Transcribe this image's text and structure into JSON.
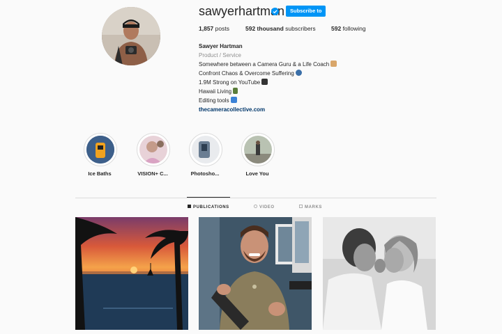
{
  "profile": {
    "username": "sawyerhartman",
    "subscribe_label": "Subscribe to",
    "posts_count": "1,857",
    "posts_label": "posts",
    "subscribers_count": "592 thousand",
    "subscribers_label": "subscribers",
    "following_count": "592",
    "following_label": "following"
  },
  "bio": {
    "name": "Sawyer Hartman",
    "category": "Product / Service",
    "lines": [
      "Somewhere between a Camera Guru & a Life Coach",
      "Confront Chaos & Overcome Suffering",
      "1.9M Strong on YouTube",
      "Hawaii Living",
      "Editing tools"
    ],
    "link": "thecameracollective.com"
  },
  "highlights": [
    {
      "label": "Ice Baths"
    },
    {
      "label": "VISION+ C..."
    },
    {
      "label": "Photosho..."
    },
    {
      "label": "Love You"
    }
  ],
  "tabs": [
    {
      "label": "PUBLICATIONS",
      "icon": "grid-icon"
    },
    {
      "label": "VIDEO",
      "icon": "video-icon"
    },
    {
      "label": "MARKS",
      "icon": "tag-icon"
    }
  ],
  "posts": [
    {
      "icon": "sunset-photo"
    },
    {
      "icon": "man-with-camera-photo"
    },
    {
      "icon": "couple-photo"
    }
  ],
  "colors": {
    "accent": "#0095f6",
    "link": "#00376b",
    "text": "#262626",
    "muted": "#8e8e8e",
    "background": "#fafafa"
  }
}
